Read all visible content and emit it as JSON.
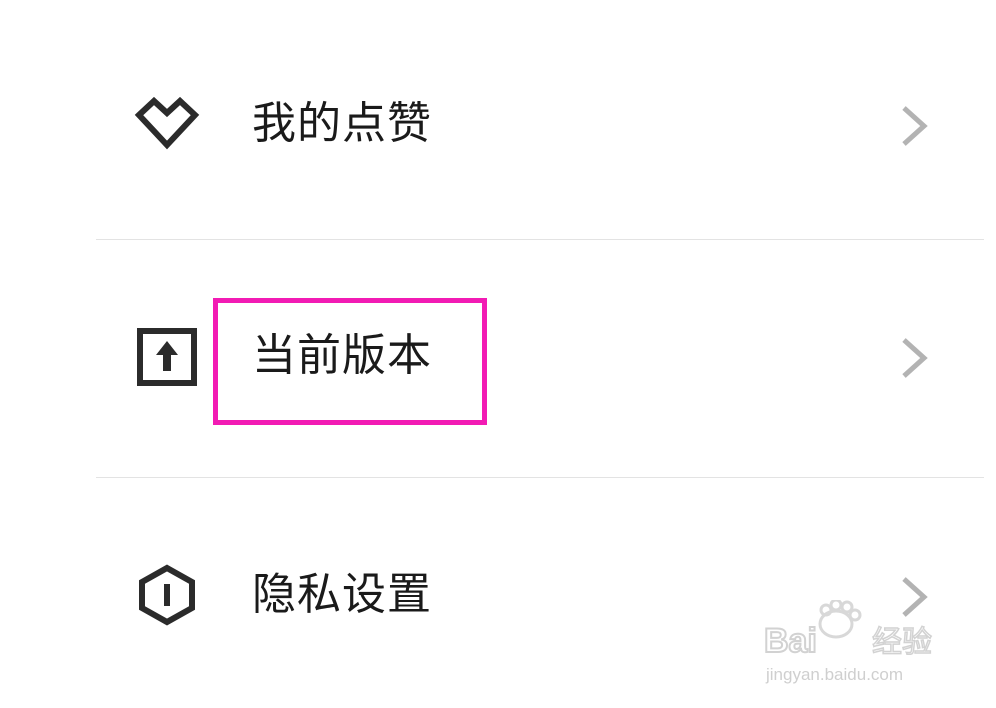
{
  "menu": {
    "items": [
      {
        "label": "我的点赞",
        "icon": "heart-diamond-icon"
      },
      {
        "label": "当前版本",
        "icon": "upload-box-icon"
      },
      {
        "label": "隐私设置",
        "icon": "hexagon-shield-icon"
      }
    ],
    "chevron_icon": "chevron-right-icon",
    "highlight_color": "#f21bb4"
  },
  "watermark": {
    "brand": "Baidu经验",
    "url": "jingyan.baidu.com"
  }
}
